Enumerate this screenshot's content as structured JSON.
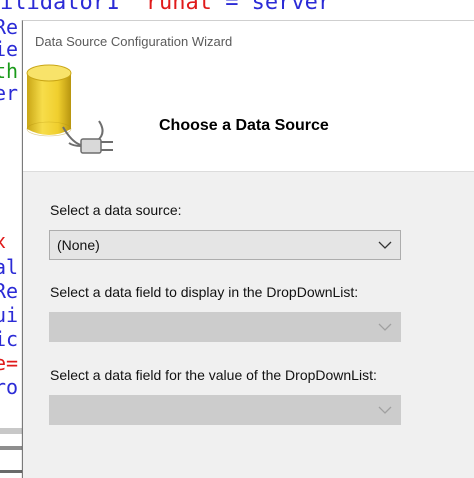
{
  "background_code": {
    "top_line": {
      "part_a": "ilidator1\"",
      "part_b": "runat",
      "part_c": "=\"server\""
    },
    "left_fragments": [
      {
        "text": "Re",
        "color": "#2b2bd6"
      },
      {
        "text": "ie",
        "color": "#2b2bd6"
      },
      {
        "text": "th",
        "color": "#1a9a1a"
      },
      {
        "text": "er",
        "color": "#2b2bd6"
      },
      {
        "text": "x",
        "color": "#e01a1a"
      },
      {
        "text": "al",
        "color": "#2b2bd6"
      },
      {
        "text": "Re",
        "color": "#2b2bd6"
      },
      {
        "text": "ui",
        "color": "#2b2bd6"
      },
      {
        "text": "ic",
        "color": "#2b2bd6"
      },
      {
        "text": "e=",
        "color": "#e01a1a"
      },
      {
        "text": "ro",
        "color": "#2b2bd6"
      }
    ]
  },
  "dialog": {
    "title": "Data Source Configuration Wizard",
    "header_title": "Choose a Data Source",
    "fields": [
      {
        "label": "Select a data source:",
        "value": "(None)",
        "enabled": true
      },
      {
        "label": "Select a data field to display in the DropDownList:",
        "value": "",
        "enabled": false
      },
      {
        "label": "Select a data field for the value of the DropDownList:",
        "value": "",
        "enabled": false
      }
    ]
  },
  "icons": {
    "header": "database-plug-icon",
    "dropdown": "chevron-down-icon"
  },
  "colors": {
    "dialog_bg": "#f0f0f0",
    "header_bg": "#ffffff",
    "select_bg": "#e5e5e5",
    "select_disabled_bg": "#cccccc",
    "cylinder": "#f2d23a"
  }
}
